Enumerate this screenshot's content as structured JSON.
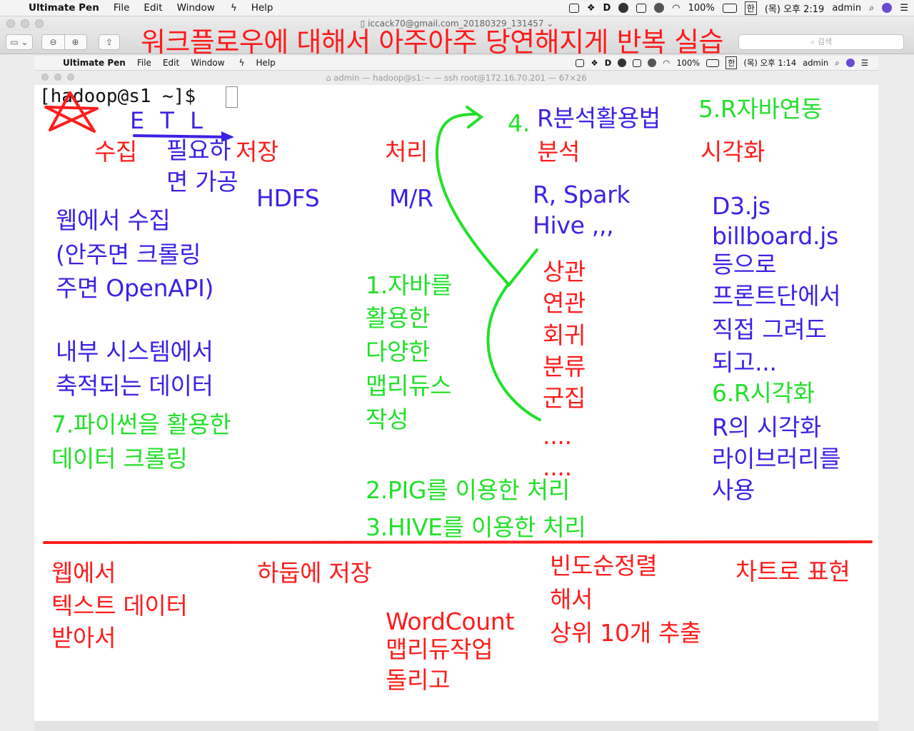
{
  "outer_menubar": {
    "app_name": "Ultimate Pen",
    "menus": [
      "File",
      "Edit",
      "Window",
      "Help"
    ],
    "battery": "100%",
    "input_source": "한",
    "datetime": "(목) 오후 2:19",
    "user": "admin"
  },
  "preview_window": {
    "title": "iccack70@gmail.com_20180329_131457 ⌄",
    "search_placeholder": "검색"
  },
  "banner": "워크플로우에 대해서 아주아주 당연해지게 반복 실습",
  "inner_menubar": {
    "app_name": "Ultimate Pen",
    "menus": [
      "File",
      "Edit",
      "Window",
      "Help"
    ],
    "battery": "100%",
    "input_source": "한",
    "datetime": "(목) 오후 1:14",
    "user": "admin"
  },
  "terminal": {
    "title": "admin — hadoop@s1:~ — ssh root@172.16.70.201 — 67×26",
    "prompt": "[hadoop@s1 ~]$"
  },
  "notes": {
    "etl": "E T L",
    "collect": "수집",
    "process_if_needed_1": "필요하",
    "process_if_needed_2": "면 가공",
    "store": "저장",
    "hdfs": "HDFS",
    "handle": "처리",
    "mr": "M/R",
    "analysis_title": "4.R분석활용법",
    "four": "4.",
    "analysis_title_text": "R분석활용법",
    "analysis": "분석",
    "r_spark": "R, Spark",
    "hive": "Hive ,,,",
    "r_java": "5.R자바연동",
    "visualize": "시각화",
    "web_collect": [
      "웹에서 수집",
      "(안주면 크롤링",
      "주면 OpenAPI)"
    ],
    "internal_data": [
      "내부 시스템에서",
      "축적되는 데이터"
    ],
    "python_crawl": [
      "7.파이썬을 활용한",
      "데이터 크롤링"
    ],
    "java_mr": [
      "1.자바를",
      "활용한",
      "다양한",
      "맵리듀스",
      "작성"
    ],
    "stats": [
      "상관",
      "연관",
      "회귀",
      "분류",
      "군집",
      "....",
      "...."
    ],
    "pig": "2.PIG를 이용한 처리",
    "hive_proc": "3.HIVE를 이용한 처리",
    "frontend": [
      "D3.js",
      "billboard.js",
      "등으로",
      "프론트단에서",
      "직접 그려도",
      "되고..."
    ],
    "r_viz_title": "6.R시각화",
    "r_viz": [
      "R의 시각화",
      "라이브러리를",
      "사용"
    ],
    "web_text": [
      "웹에서",
      "텍스트 데이터",
      "받아서"
    ],
    "hadoop_store": "하둡에 저장",
    "wordcount": [
      "WordCount",
      "맵리듀작업",
      "돌리고"
    ],
    "freq": [
      "빈도순정렬",
      "해서",
      "상위 10개 추출"
    ],
    "chart": "차트로 표현"
  },
  "colors": {
    "blue_ink": "#3a22e6",
    "red_ink": "#ff1c1c",
    "green_ink": "#22e02a"
  }
}
